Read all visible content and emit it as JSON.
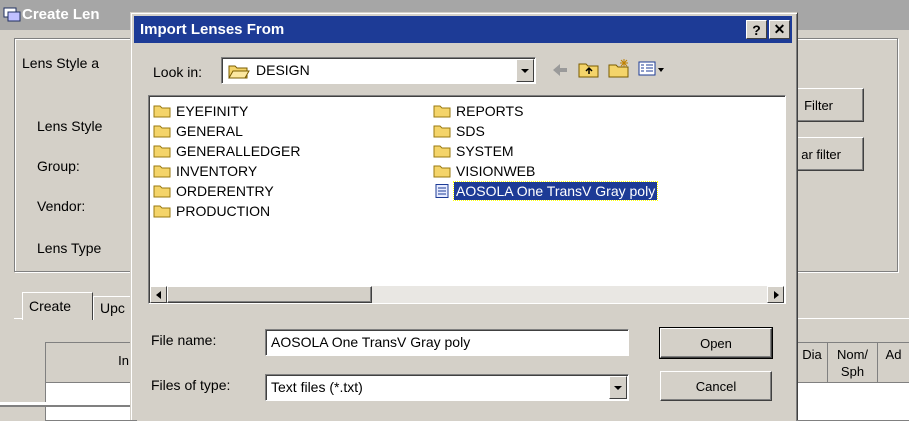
{
  "background_window": {
    "title": "Create Len",
    "group_title": "Lens Style a",
    "labels": {
      "lens_style": "Lens Style",
      "group": "Group:",
      "vendor": "Vendor:",
      "lens_type": "Lens Type"
    },
    "filter_button": "Filter",
    "clear_filter_button": "ar filter",
    "tabs": [
      "Create",
      "Upc"
    ],
    "grid_headers": {
      "col_in": "In",
      "dia": "Dia",
      "nom_sph": "Nom/ Sph",
      "ad": "Ad"
    }
  },
  "dialog": {
    "title": "Import Lenses From",
    "help_button": "?",
    "close_button": "✕",
    "look_in_label": "Look in:",
    "look_in_value": "DESIGN",
    "toolbar_icons": [
      "back-arrow-icon",
      "up-folder-icon",
      "new-folder-icon",
      "view-menu-icon"
    ],
    "files_col1": [
      "EYEFINITY",
      "GENERAL",
      "GENERALLEDGER",
      "INVENTORY",
      "ORDERENTRY",
      "PRODUCTION"
    ],
    "files_col2": [
      "REPORTS",
      "SDS",
      "SYSTEM",
      "VISIONWEB"
    ],
    "selected_file": "AOSOLA One TransV Gray poly",
    "file_name_label": "File name:",
    "file_name_value": "AOSOLA One TransV Gray poly",
    "files_of_type_label": "Files of type:",
    "files_of_type_value": "Text files (*.txt)",
    "open_button": "Open",
    "cancel_button": "Cancel",
    "colors": {
      "title_bar": "#1d3b96",
      "selection": "#1d3b96",
      "folder": "#f4d46a"
    }
  }
}
